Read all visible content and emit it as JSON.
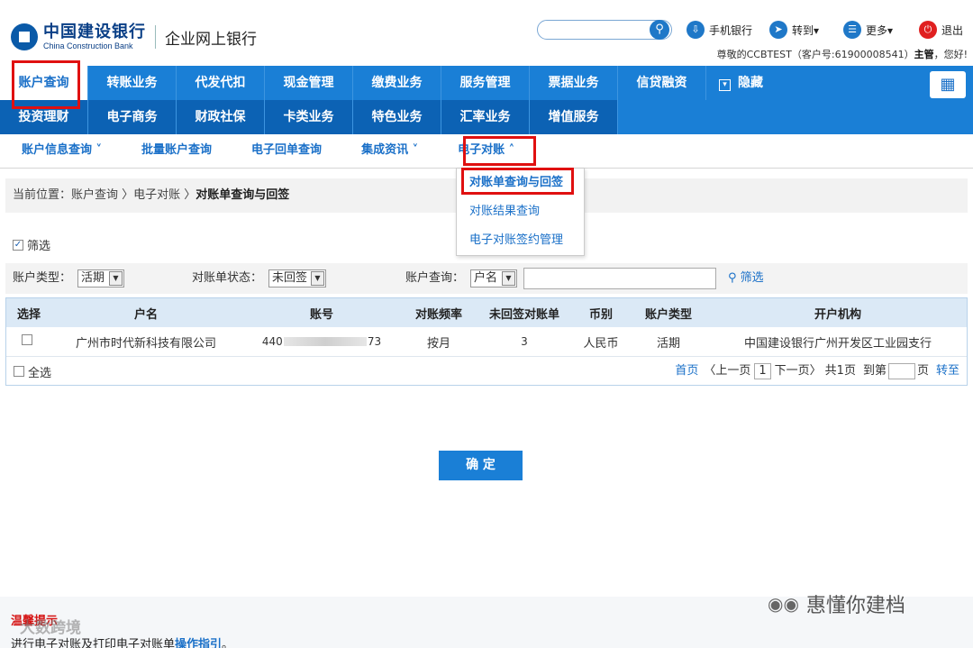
{
  "header": {
    "logo_cn": "中国建设银行",
    "logo_en": "China Construction Bank",
    "subtitle": "企业网上银行",
    "mobile_bank": "手机银行",
    "goto": "转到▾",
    "more": "更多▾",
    "logout": "退出",
    "welcome_prefix": "尊敬的CCBTEST（客户号:61900008541）",
    "welcome_role": "主管",
    "welcome_suffix": "，您好!"
  },
  "nav": {
    "row1": [
      "账户查询",
      "转账业务",
      "代发代扣",
      "现金管理",
      "缴费业务",
      "服务管理",
      "票据业务",
      "信贷融资"
    ],
    "hide": "隐藏",
    "row2": [
      "投资理财",
      "电子商务",
      "财政社保",
      "卡类业务",
      "特色业务",
      "汇率业务",
      "增值服务"
    ]
  },
  "subnav": [
    "账户信息查询 ˅",
    "批量账户查询",
    "电子回单查询",
    "集成资讯 ˅",
    "电子对账 ˄"
  ],
  "dropdown": [
    "对账单查询与回签",
    "对账结果查询",
    "电子对账签约管理"
  ],
  "breadcrumb": {
    "prefix": "当前位置：账户查询 〉电子对账 〉",
    "current": "对账单查询与回签"
  },
  "filter": {
    "toggle_label": "筛选",
    "account_type_label": "账户类型：",
    "account_type_value": "活期",
    "status_label": "对账单状态：",
    "status_value": "未回签",
    "query_label": "账户查询：",
    "query_field_value": "户名",
    "query_input_value": "",
    "filter_button": "筛选"
  },
  "table": {
    "headers": [
      "选择",
      "户名",
      "账号",
      "对账频率",
      "未回签对账单",
      "币别",
      "账户类型",
      "开户机构"
    ],
    "rows": [
      {
        "name": "广州市时代新科技有限公司",
        "account_prefix": "440",
        "account_suffix": "73",
        "frequency": "按月",
        "unsigned": "3",
        "currency": "人民币",
        "type": "活期",
        "branch": "中国建设银行广州开发区工业园支行"
      }
    ],
    "select_all": "全选"
  },
  "pager": {
    "first": "首页",
    "prev": "〈上一页",
    "page": "1",
    "next": "下一页〉",
    "total": "共1页",
    "goto_label": "到第",
    "page_unit": "页",
    "go": "转至"
  },
  "confirm_label": "确 定",
  "tips": {
    "title": "温馨提示",
    "text": "进行电子对账及打印电子对账单",
    "link": "操作指引",
    "end": "。"
  },
  "watermark": "大数跨境",
  "wechat_account": "惠懂你建档",
  "colors": {
    "nav_blue": "#1a7fd6",
    "nav_dark": "#0c62b4",
    "highlight_red": "#e01010",
    "link_blue": "#1a70c8"
  }
}
